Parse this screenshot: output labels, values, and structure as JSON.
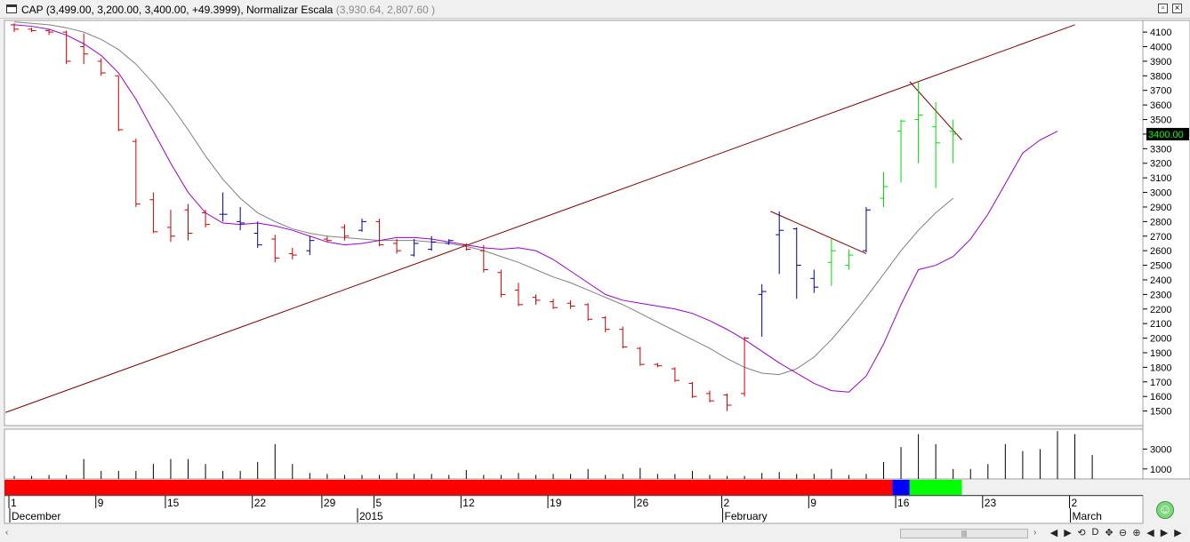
{
  "window": {
    "symbol": "CAP",
    "ohlc_text": "(3,499.00, 3,200.00, 3,400.00, +49.3999)",
    "scale_label": "Normalizar Escala",
    "scale_range_text": "(3,930.64, 2,807.60 )",
    "buttons": [
      "restore",
      "close"
    ]
  },
  "colors": {
    "down_bar": "#cc0000",
    "up_bar": "#000099",
    "green_bar": "#00dd00",
    "fast_ma": "#9900cc",
    "slow_ma": "#808080",
    "trendline": "#800000",
    "last_price_bg": "#000000",
    "last_price_fg": "#00ff00",
    "band_red": "#ff0000",
    "band_blue": "#0000ff",
    "band_green": "#00ff00"
  },
  "chart_data": [
    {
      "type": "ohlc",
      "name": "price",
      "y_ticks": [
        1500,
        1600,
        1700,
        1800,
        1900,
        2000,
        2100,
        2200,
        2300,
        2400,
        2500,
        2600,
        2700,
        2800,
        2900,
        3000,
        3100,
        3200,
        3300,
        3400,
        3500,
        3600,
        3700,
        3800,
        3900,
        4000,
        4100
      ],
      "y_tick_labels": [
        "1500",
        "1600",
        "1700",
        "1800",
        "1900",
        "2000",
        "2100",
        "2200",
        "2300",
        "2400",
        "2500",
        "2600",
        "2700",
        "2800",
        "2900",
        "3000",
        "3100",
        "3200",
        "3300",
        "3400",
        "3500",
        "3600",
        "3700",
        "3800",
        "3900",
        "4000",
        "4100"
      ],
      "ylim": [
        1400,
        4180
      ],
      "last_price_label": "3400.00",
      "last_price": 3400,
      "bars": [
        {
          "h": 4160,
          "l": 4100,
          "o": 4150,
          "c": 4120,
          "col": "d"
        },
        {
          "h": 4130,
          "l": 4100,
          "o": 4120,
          "c": 4110,
          "col": "d"
        },
        {
          "h": 4120,
          "l": 4080,
          "o": 4110,
          "c": 4100,
          "col": "d"
        },
        {
          "h": 4110,
          "l": 3880,
          "o": 4100,
          "c": 3900,
          "col": "d"
        },
        {
          "h": 4090,
          "l": 3880,
          "o": 4000,
          "c": 3950,
          "col": "d"
        },
        {
          "h": 3920,
          "l": 3800,
          "o": 3900,
          "c": 3820,
          "col": "d"
        },
        {
          "h": 3800,
          "l": 3420,
          "o": 3800,
          "c": 3430,
          "col": "d"
        },
        {
          "h": 3370,
          "l": 2900,
          "o": 3350,
          "c": 2920,
          "col": "d"
        },
        {
          "h": 3000,
          "l": 2720,
          "o": 2950,
          "c": 2730,
          "col": "d"
        },
        {
          "h": 2880,
          "l": 2660,
          "o": 2760,
          "c": 2700,
          "col": "d"
        },
        {
          "h": 2920,
          "l": 2670,
          "o": 2880,
          "c": 2720,
          "col": "d"
        },
        {
          "h": 2880,
          "l": 2760,
          "o": 2860,
          "c": 2780,
          "col": "d"
        },
        {
          "h": 3000,
          "l": 2800,
          "o": 2850,
          "c": 2850,
          "col": "u"
        },
        {
          "h": 2900,
          "l": 2740,
          "o": 2800,
          "c": 2790,
          "col": "u"
        },
        {
          "h": 2800,
          "l": 2620,
          "o": 2720,
          "c": 2640,
          "col": "u"
        },
        {
          "h": 2710,
          "l": 2520,
          "o": 2680,
          "c": 2550,
          "col": "d"
        },
        {
          "h": 2620,
          "l": 2540,
          "o": 2580,
          "c": 2570,
          "col": "d"
        },
        {
          "h": 2700,
          "l": 2570,
          "o": 2600,
          "c": 2670,
          "col": "u"
        },
        {
          "h": 2700,
          "l": 2660,
          "o": 2680,
          "c": 2670,
          "col": "d"
        },
        {
          "h": 2780,
          "l": 2670,
          "o": 2760,
          "c": 2700,
          "col": "d"
        },
        {
          "h": 2820,
          "l": 2730,
          "o": 2740,
          "c": 2800,
          "col": "u"
        },
        {
          "h": 2820,
          "l": 2630,
          "o": 2800,
          "c": 2640,
          "col": "d"
        },
        {
          "h": 2680,
          "l": 2580,
          "o": 2650,
          "c": 2600,
          "col": "d"
        },
        {
          "h": 2680,
          "l": 2560,
          "o": 2570,
          "c": 2650,
          "col": "u"
        },
        {
          "h": 2700,
          "l": 2600,
          "o": 2610,
          "c": 2660,
          "col": "u"
        },
        {
          "h": 2680,
          "l": 2640,
          "o": 2650,
          "c": 2670,
          "col": "u"
        },
        {
          "h": 2650,
          "l": 2600,
          "o": 2640,
          "c": 2610,
          "col": "d"
        },
        {
          "h": 2640,
          "l": 2450,
          "o": 2600,
          "c": 2470,
          "col": "d"
        },
        {
          "h": 2470,
          "l": 2280,
          "o": 2450,
          "c": 2300,
          "col": "d"
        },
        {
          "h": 2380,
          "l": 2220,
          "o": 2330,
          "c": 2230,
          "col": "d"
        },
        {
          "h": 2300,
          "l": 2230,
          "o": 2280,
          "c": 2260,
          "col": "d"
        },
        {
          "h": 2270,
          "l": 2200,
          "o": 2250,
          "c": 2210,
          "col": "d"
        },
        {
          "h": 2260,
          "l": 2200,
          "o": 2240,
          "c": 2220,
          "col": "d"
        },
        {
          "h": 2240,
          "l": 2120,
          "o": 2230,
          "c": 2130,
          "col": "d"
        },
        {
          "h": 2150,
          "l": 2040,
          "o": 2140,
          "c": 2060,
          "col": "d"
        },
        {
          "h": 2080,
          "l": 1930,
          "o": 2060,
          "c": 1940,
          "col": "d"
        },
        {
          "h": 1940,
          "l": 1810,
          "o": 1930,
          "c": 1820,
          "col": "d"
        },
        {
          "h": 1830,
          "l": 1800,
          "o": 1820,
          "c": 1810,
          "col": "d"
        },
        {
          "h": 1800,
          "l": 1700,
          "o": 1790,
          "c": 1710,
          "col": "d"
        },
        {
          "h": 1700,
          "l": 1590,
          "o": 1690,
          "c": 1600,
          "col": "d"
        },
        {
          "h": 1640,
          "l": 1560,
          "o": 1620,
          "c": 1570,
          "col": "d"
        },
        {
          "h": 1620,
          "l": 1500,
          "o": 1610,
          "c": 1540,
          "col": "d"
        },
        {
          "h": 2010,
          "l": 1600,
          "o": 1620,
          "c": 2000,
          "col": "d"
        },
        {
          "h": 2370,
          "l": 2010,
          "o": 2300,
          "c": 2320,
          "col": "u"
        },
        {
          "h": 2870,
          "l": 2440,
          "o": 2710,
          "c": 2740,
          "col": "u"
        },
        {
          "h": 2760,
          "l": 2270,
          "o": 2750,
          "c": 2500,
          "col": "u"
        },
        {
          "h": 2470,
          "l": 2310,
          "o": 2410,
          "c": 2350,
          "col": "u"
        },
        {
          "h": 2680,
          "l": 2360,
          "o": 2520,
          "c": 2600,
          "col": "g"
        },
        {
          "h": 2610,
          "l": 2470,
          "o": 2500,
          "c": 2570,
          "col": "g"
        },
        {
          "h": 2900,
          "l": 2590,
          "o": 2600,
          "c": 2880,
          "col": "u"
        },
        {
          "h": 3140,
          "l": 2900,
          "o": 2960,
          "c": 3040,
          "col": "g"
        },
        {
          "h": 3500,
          "l": 3070,
          "o": 3420,
          "c": 3490,
          "col": "g"
        },
        {
          "h": 3760,
          "l": 3200,
          "o": 3500,
          "c": 3530,
          "col": "g"
        },
        {
          "h": 3620,
          "l": 3030,
          "o": 3450,
          "c": 3340,
          "col": "g"
        },
        {
          "h": 3499,
          "l": 3200,
          "o": 3420,
          "c": 3400,
          "col": "g"
        }
      ],
      "fast_ma": [
        4150,
        4140,
        4120,
        4080,
        4020,
        3940,
        3820,
        3640,
        3420,
        3200,
        3000,
        2860,
        2790,
        2780,
        2790,
        2770,
        2740,
        2700,
        2660,
        2640,
        2650,
        2670,
        2690,
        2690,
        2680,
        2660,
        2640,
        2620,
        2610,
        2620,
        2600,
        2540,
        2460,
        2380,
        2300,
        2260,
        2240,
        2220,
        2200,
        2170,
        2120,
        2060,
        1990,
        1910,
        1830,
        1760,
        1690,
        1640,
        1630,
        1740,
        1960,
        2230,
        2470,
        2500,
        2560,
        2680,
        2850,
        3060,
        3270,
        3360,
        3420
      ],
      "slow_ma": [
        4170,
        4160,
        4150,
        4130,
        4100,
        4050,
        3980,
        3880,
        3750,
        3600,
        3430,
        3250,
        3090,
        2960,
        2860,
        2800,
        2750,
        2720,
        2700,
        2690,
        2680,
        2670,
        2670,
        2670,
        2660,
        2650,
        2630,
        2600,
        2560,
        2520,
        2470,
        2420,
        2380,
        2330,
        2280,
        2230,
        2170,
        2110,
        2050,
        1990,
        1930,
        1860,
        1800,
        1760,
        1750,
        1790,
        1870,
        1990,
        2130,
        2280,
        2440,
        2600,
        2740,
        2860,
        2960
      ],
      "trendlines": [
        {
          "p1": [
            -0.5,
            1490
          ],
          "p2": [
            61,
            4150
          ]
        },
        {
          "p1": [
            43.5,
            2870
          ],
          "p2": [
            49,
            2580
          ]
        },
        {
          "p1": [
            51.5,
            3760
          ],
          "p2": [
            54.5,
            3360
          ]
        }
      ],
      "x_labels": [
        {
          "day": "1",
          "bar": 0
        },
        {
          "day": "9",
          "bar": 5
        },
        {
          "day": "15",
          "bar": 9
        },
        {
          "day": "22",
          "bar": 14
        },
        {
          "day": "29",
          "bar": 18
        },
        {
          "day": "5",
          "bar": 21
        },
        {
          "day": "12",
          "bar": 26
        },
        {
          "day": "19",
          "bar": 31
        },
        {
          "day": "26",
          "bar": 36
        },
        {
          "day": "2",
          "bar": 41
        },
        {
          "day": "9",
          "bar": 46
        },
        {
          "day": "16",
          "bar": 51
        },
        {
          "day": "23",
          "bar": 56
        },
        {
          "day": "2",
          "bar": 61
        }
      ],
      "month_labels": [
        {
          "text": "December",
          "bar": 0
        },
        {
          "text": "2015",
          "bar": 20
        },
        {
          "text": "February",
          "bar": 41
        },
        {
          "text": "March",
          "bar": 61
        }
      ]
    },
    {
      "type": "bar",
      "name": "volume",
      "y_ticks": [
        1000,
        3000
      ],
      "y_tick_labels": [
        "1000",
        "3000"
      ],
      "ylim": [
        0,
        5000
      ],
      "values": [
        300,
        300,
        400,
        400,
        2000,
        800,
        800,
        800,
        1500,
        2000,
        2000,
        1500,
        800,
        800,
        1700,
        3500,
        1500,
        600,
        500,
        400,
        400,
        400,
        600,
        500,
        500,
        400,
        900,
        400,
        400,
        600,
        400,
        500,
        500,
        1000,
        400,
        500,
        1100,
        500,
        500,
        800,
        400,
        300,
        300,
        600,
        700,
        500,
        500,
        1000,
        400,
        500,
        1700,
        3200,
        4500,
        3500,
        1000,
        1000,
        1500,
        3500,
        2800,
        3000,
        4800,
        4500,
        2400
      ]
    }
  ],
  "status_band": {
    "segments": [
      {
        "color": "red",
        "from": 0,
        "to": 51
      },
      {
        "color": "blue",
        "from": 51,
        "to": 52
      },
      {
        "color": "green",
        "from": 52,
        "to": 55
      }
    ]
  },
  "toolbar": {
    "scroll_thumb": "|||",
    "tools": [
      "◀",
      "▶",
      "⟲",
      "D",
      "✥",
      "⊖",
      "⊕",
      "◀",
      "▶",
      "▶"
    ]
  }
}
